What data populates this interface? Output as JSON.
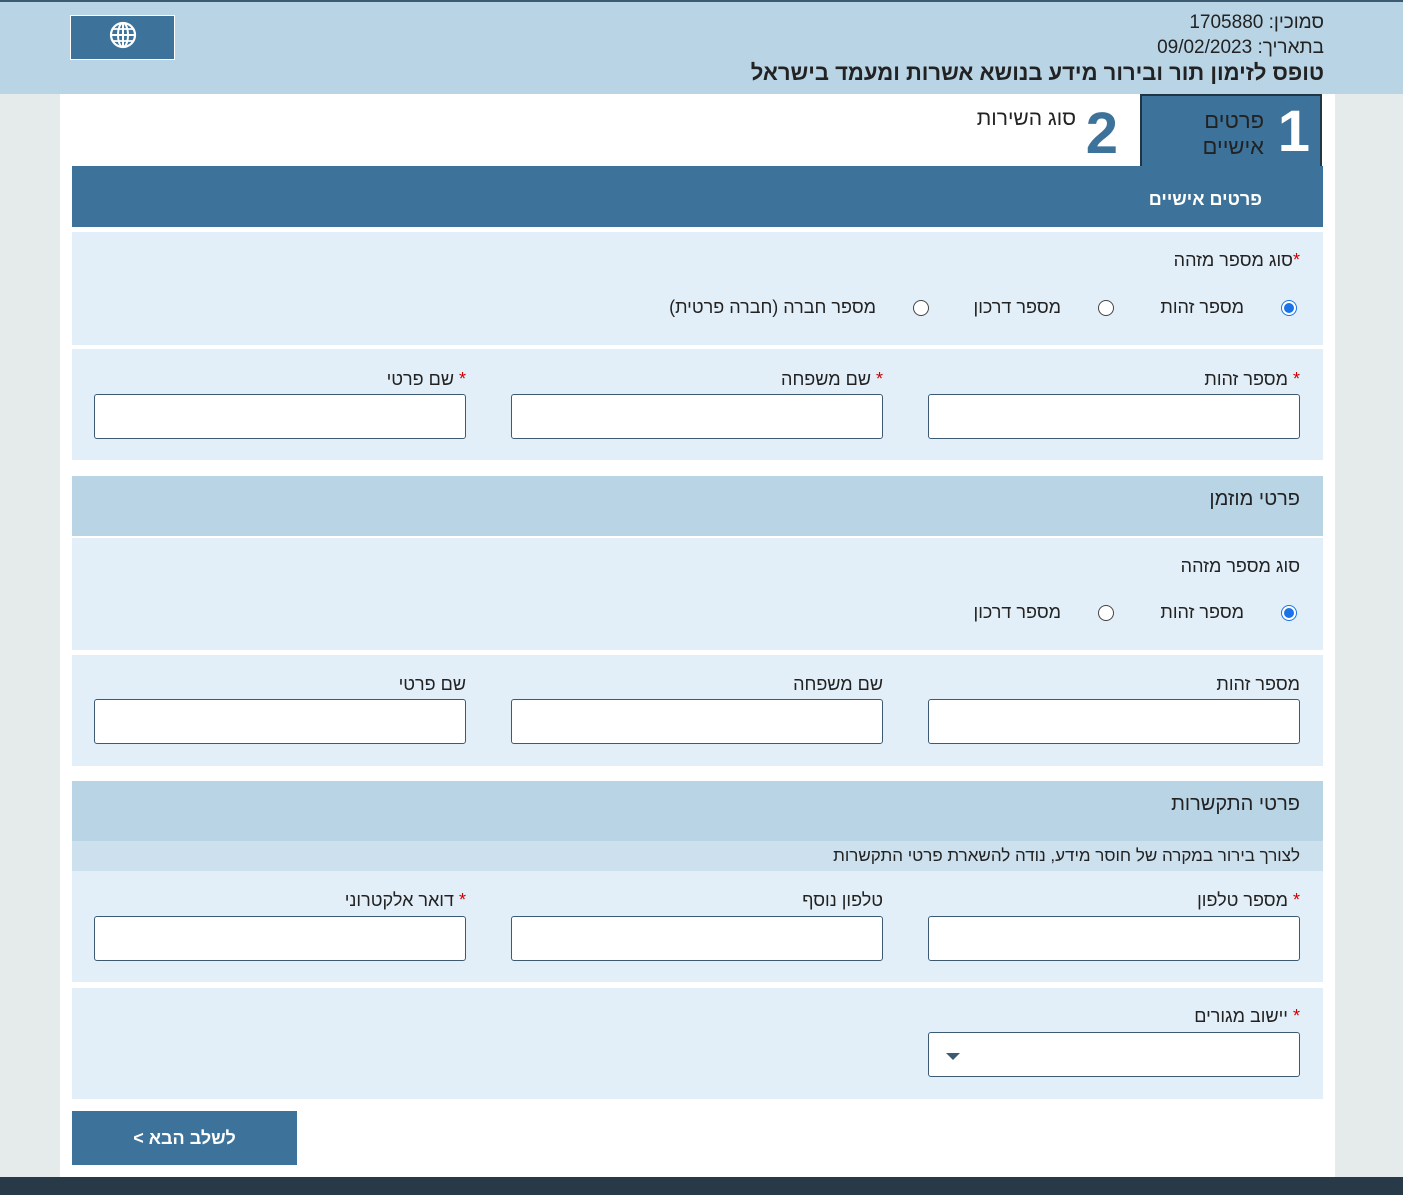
{
  "header": {
    "agent_label": "סמוכין:",
    "agent_value": "1705880",
    "date_label": "בתאריך:",
    "date_value": "09/02/2023",
    "title": "טופס לזימון תור ובירור מידע בנושא אשרות ומעמד בישראל",
    "language_icon": "globe-icon"
  },
  "steps": [
    {
      "number": "1",
      "label_line1": "פרטים",
      "label_line2": "אישיים",
      "active": true
    },
    {
      "number": "2",
      "label": "סוג השירות",
      "active": false
    }
  ],
  "personal": {
    "title": "פרטים אישיים",
    "id_type_label": "סוג מספר מזהה",
    "id_type_options": [
      "מספר זהות",
      "מספר דרכון",
      "מספר חברה (חברה פרטית)"
    ],
    "id_type_selected": "מספר זהות",
    "id_number_label": "מספר זהות",
    "last_name_label": "שם משפחה",
    "first_name_label": "שם פרטי",
    "required_mark": "*"
  },
  "invitee": {
    "title": "פרטי מוזמן",
    "id_type_label": "סוג מספר מזהה",
    "id_type_options": [
      "מספר זהות",
      "מספר דרכון"
    ],
    "id_type_selected": "מספר זהות",
    "id_number_label": "מספר זהות",
    "last_name_label": "שם משפחה",
    "first_name_label": "שם פרטי"
  },
  "contact": {
    "title": "פרטי התקשרות",
    "note": "לצורך בירור במקרה של חוסר מידע, נודה להשארת פרטי התקשרות",
    "phone_label": "מספר טלפון",
    "extra_phone_label": "טלפון נוסף",
    "email_label": "דואר אלקטרוני",
    "city_label": "יישוב מגורים",
    "city_value": ""
  },
  "buttons": {
    "next": "לשלב הבא >"
  },
  "colors": {
    "header_bg": "#b8d4e5",
    "primary": "#3d739a",
    "panel_bg": "#e3eff8",
    "required": "#cc0000",
    "radio_checked": "#1a73e8"
  }
}
